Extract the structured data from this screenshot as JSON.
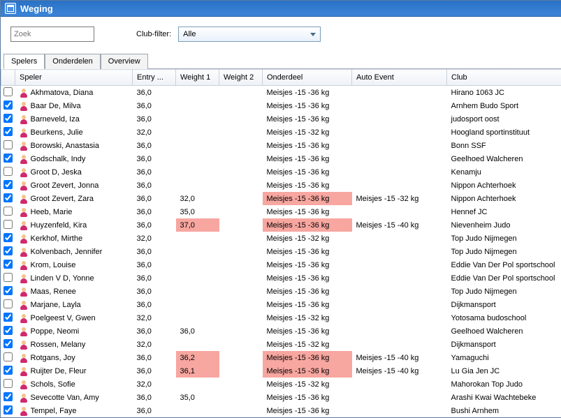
{
  "window": {
    "title": "Weging"
  },
  "search": {
    "placeholder": "Zoek"
  },
  "filter": {
    "label": "Club-filter:",
    "selected": "Alle"
  },
  "tabs": [
    {
      "label": "Spelers",
      "active": true
    },
    {
      "label": "Onderdelen",
      "active": false
    },
    {
      "label": "Overview",
      "active": false
    }
  ],
  "columns": {
    "speler": "Speler",
    "entry": "Entry ...",
    "weight1": "Weight 1",
    "weight2": "Weight 2",
    "onderdeel": "Onderdeel",
    "auto": "Auto Event",
    "club": "Club"
  },
  "rows": [
    {
      "checked": false,
      "name": "Akhmatova, Diana",
      "entry": "36,0",
      "w1": "",
      "w2": "",
      "onderdeel": "Meisjes -15 -36 kg",
      "auto": "",
      "club": "Hirano 1063 JC"
    },
    {
      "checked": true,
      "name": "Baar De, Milva",
      "entry": "36,0",
      "w1": "",
      "w2": "",
      "onderdeel": "Meisjes -15 -36 kg",
      "auto": "",
      "club": "Arnhem Budo Sport"
    },
    {
      "checked": true,
      "name": "Barneveld, Iza",
      "entry": "36,0",
      "w1": "",
      "w2": "",
      "onderdeel": "Meisjes -15 -36 kg",
      "auto": "",
      "club": "judosport oost"
    },
    {
      "checked": true,
      "name": "Beurkens, Julie",
      "entry": "32,0",
      "w1": "",
      "w2": "",
      "onderdeel": "Meisjes -15 -32 kg",
      "auto": "",
      "club": "Hoogland sportinstituut"
    },
    {
      "checked": false,
      "name": "Borowski, Anastasia",
      "entry": "36,0",
      "w1": "",
      "w2": "",
      "onderdeel": "Meisjes -15 -36 kg",
      "auto": "",
      "club": "Bonn SSF"
    },
    {
      "checked": true,
      "name": "Godschalk, Indy",
      "entry": "36,0",
      "w1": "",
      "w2": "",
      "onderdeel": "Meisjes -15 -36 kg",
      "auto": "",
      "club": "Geelhoed Walcheren"
    },
    {
      "checked": false,
      "name": "Groot D, Jeska",
      "entry": "36,0",
      "w1": "",
      "w2": "",
      "onderdeel": "Meisjes -15 -36 kg",
      "auto": "",
      "club": "Kenamju"
    },
    {
      "checked": true,
      "name": "Groot Zevert, Jonna",
      "entry": "36,0",
      "w1": "",
      "w2": "",
      "onderdeel": "Meisjes -15 -36 kg",
      "auto": "",
      "club": "Nippon Achterhoek"
    },
    {
      "checked": true,
      "name": "Groot Zevert, Zara",
      "entry": "36,0",
      "w1": "32,0",
      "w2": "",
      "onderdeel": "Meisjes -15 -36 kg",
      "onderdeel_hl": true,
      "auto": "Meisjes -15 -32 kg",
      "club": "Nippon Achterhoek"
    },
    {
      "checked": false,
      "name": "Heeb, Marie",
      "entry": "36,0",
      "w1": "35,0",
      "w2": "",
      "onderdeel": "Meisjes -15 -36 kg",
      "auto": "",
      "club": "Hennef JC"
    },
    {
      "checked": false,
      "name": "Huyzenfeld, Kira",
      "entry": "36,0",
      "w1": "37,0",
      "w1_hl": true,
      "w2": "",
      "onderdeel": "Meisjes -15 -36 kg",
      "onderdeel_hl": true,
      "auto": "Meisjes -15 -40 kg",
      "club": "Nievenheim Judo"
    },
    {
      "checked": true,
      "name": "Kerkhof, Mirthe",
      "entry": "32,0",
      "w1": "",
      "w2": "",
      "onderdeel": "Meisjes -15 -32 kg",
      "auto": "",
      "club": "Top Judo Nijmegen"
    },
    {
      "checked": true,
      "name": "Kolvenbach, Jennifer",
      "entry": "36,0",
      "w1": "",
      "w2": "",
      "onderdeel": "Meisjes -15 -36 kg",
      "auto": "",
      "club": "Top Judo Nijmegen"
    },
    {
      "checked": true,
      "name": "Krom, Louise",
      "entry": "36,0",
      "w1": "",
      "w2": "",
      "onderdeel": "Meisjes -15 -36 kg",
      "auto": "",
      "club": "Eddie Van Der Pol sportschool"
    },
    {
      "checked": false,
      "name": "Linden V D, Yonne",
      "entry": "36,0",
      "w1": "",
      "w2": "",
      "onderdeel": "Meisjes -15 -36 kg",
      "auto": "",
      "club": "Eddie Van Der Pol sportschool"
    },
    {
      "checked": true,
      "name": "Maas, Renee",
      "entry": "36,0",
      "w1": "",
      "w2": "",
      "onderdeel": "Meisjes -15 -36 kg",
      "auto": "",
      "club": "Top Judo Nijmegen"
    },
    {
      "checked": false,
      "name": "Marjane, Layla",
      "entry": "36,0",
      "w1": "",
      "w2": "",
      "onderdeel": "Meisjes -15 -36 kg",
      "auto": "",
      "club": "Dijkmansport"
    },
    {
      "checked": true,
      "name": "Poelgeest V, Gwen",
      "entry": "32,0",
      "w1": "",
      "w2": "",
      "onderdeel": "Meisjes -15 -32 kg",
      "auto": "",
      "club": "Yotosama budoschool"
    },
    {
      "checked": true,
      "name": "Poppe, Neomi",
      "entry": "36,0",
      "w1": "36,0",
      "w2": "",
      "onderdeel": "Meisjes -15 -36 kg",
      "auto": "",
      "club": "Geelhoed Walcheren"
    },
    {
      "checked": true,
      "name": "Rossen, Melany",
      "entry": "32,0",
      "w1": "",
      "w2": "",
      "onderdeel": "Meisjes -15 -32 kg",
      "auto": "",
      "club": "Dijkmansport"
    },
    {
      "checked": false,
      "name": "Rotgans, Joy",
      "entry": "36,0",
      "w1": "36,2",
      "w1_hl": true,
      "w2": "",
      "onderdeel": "Meisjes -15 -36 kg",
      "onderdeel_hl": true,
      "auto": "Meisjes -15 -40 kg",
      "club": "Yamaguchi"
    },
    {
      "checked": true,
      "name": "Ruijter De, Fleur",
      "entry": "36,0",
      "w1": "36,1",
      "w1_hl": true,
      "w2": "",
      "onderdeel": "Meisjes -15 -36 kg",
      "onderdeel_hl": true,
      "auto": "Meisjes -15 -40 kg",
      "club": "Lu Gia Jen JC"
    },
    {
      "checked": false,
      "name": "Schols, Sofie",
      "entry": "32,0",
      "w1": "",
      "w2": "",
      "onderdeel": "Meisjes -15 -32 kg",
      "auto": "",
      "club": "Mahorokan Top Judo"
    },
    {
      "checked": true,
      "name": "Sevecotte Van, Amy",
      "entry": "36,0",
      "w1": "35,0",
      "w2": "",
      "onderdeel": "Meisjes -15 -36 kg",
      "auto": "",
      "club": "Arashi Kwai Wachtebeke"
    },
    {
      "checked": true,
      "name": "Tempel, Faye",
      "entry": "36,0",
      "w1": "",
      "w2": "",
      "onderdeel": "Meisjes -15 -36 kg",
      "auto": "",
      "club": "Bushi Arnhem"
    }
  ]
}
